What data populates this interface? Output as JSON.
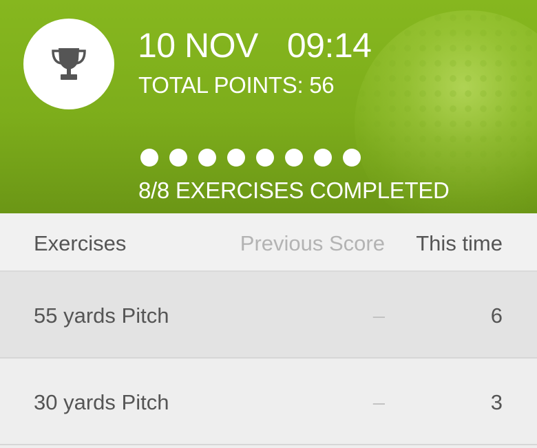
{
  "header": {
    "date": "10 NOV",
    "time": "09:14",
    "total_points": "TOTAL POINTS: 56",
    "exercise_dots": [
      {
        "completed": true
      },
      {
        "completed": true
      },
      {
        "completed": true
      },
      {
        "completed": true
      },
      {
        "completed": true
      },
      {
        "completed": true
      },
      {
        "completed": true
      },
      {
        "completed": true
      }
    ],
    "completed_text": "8/8 EXERCISES COMPLETED",
    "avatar_icon": "trophy-icon",
    "colors": {
      "accent": "#7fb01c",
      "text": "#ffffff"
    }
  },
  "table": {
    "headers": {
      "exercises": "Exercises",
      "previous_score": "Previous Score",
      "this_time": "This time"
    },
    "rows": [
      {
        "name": "55 yards Pitch",
        "previous": "–",
        "this_time": "6"
      },
      {
        "name": "30 yards Pitch",
        "previous": "–",
        "this_time": "3"
      }
    ]
  }
}
